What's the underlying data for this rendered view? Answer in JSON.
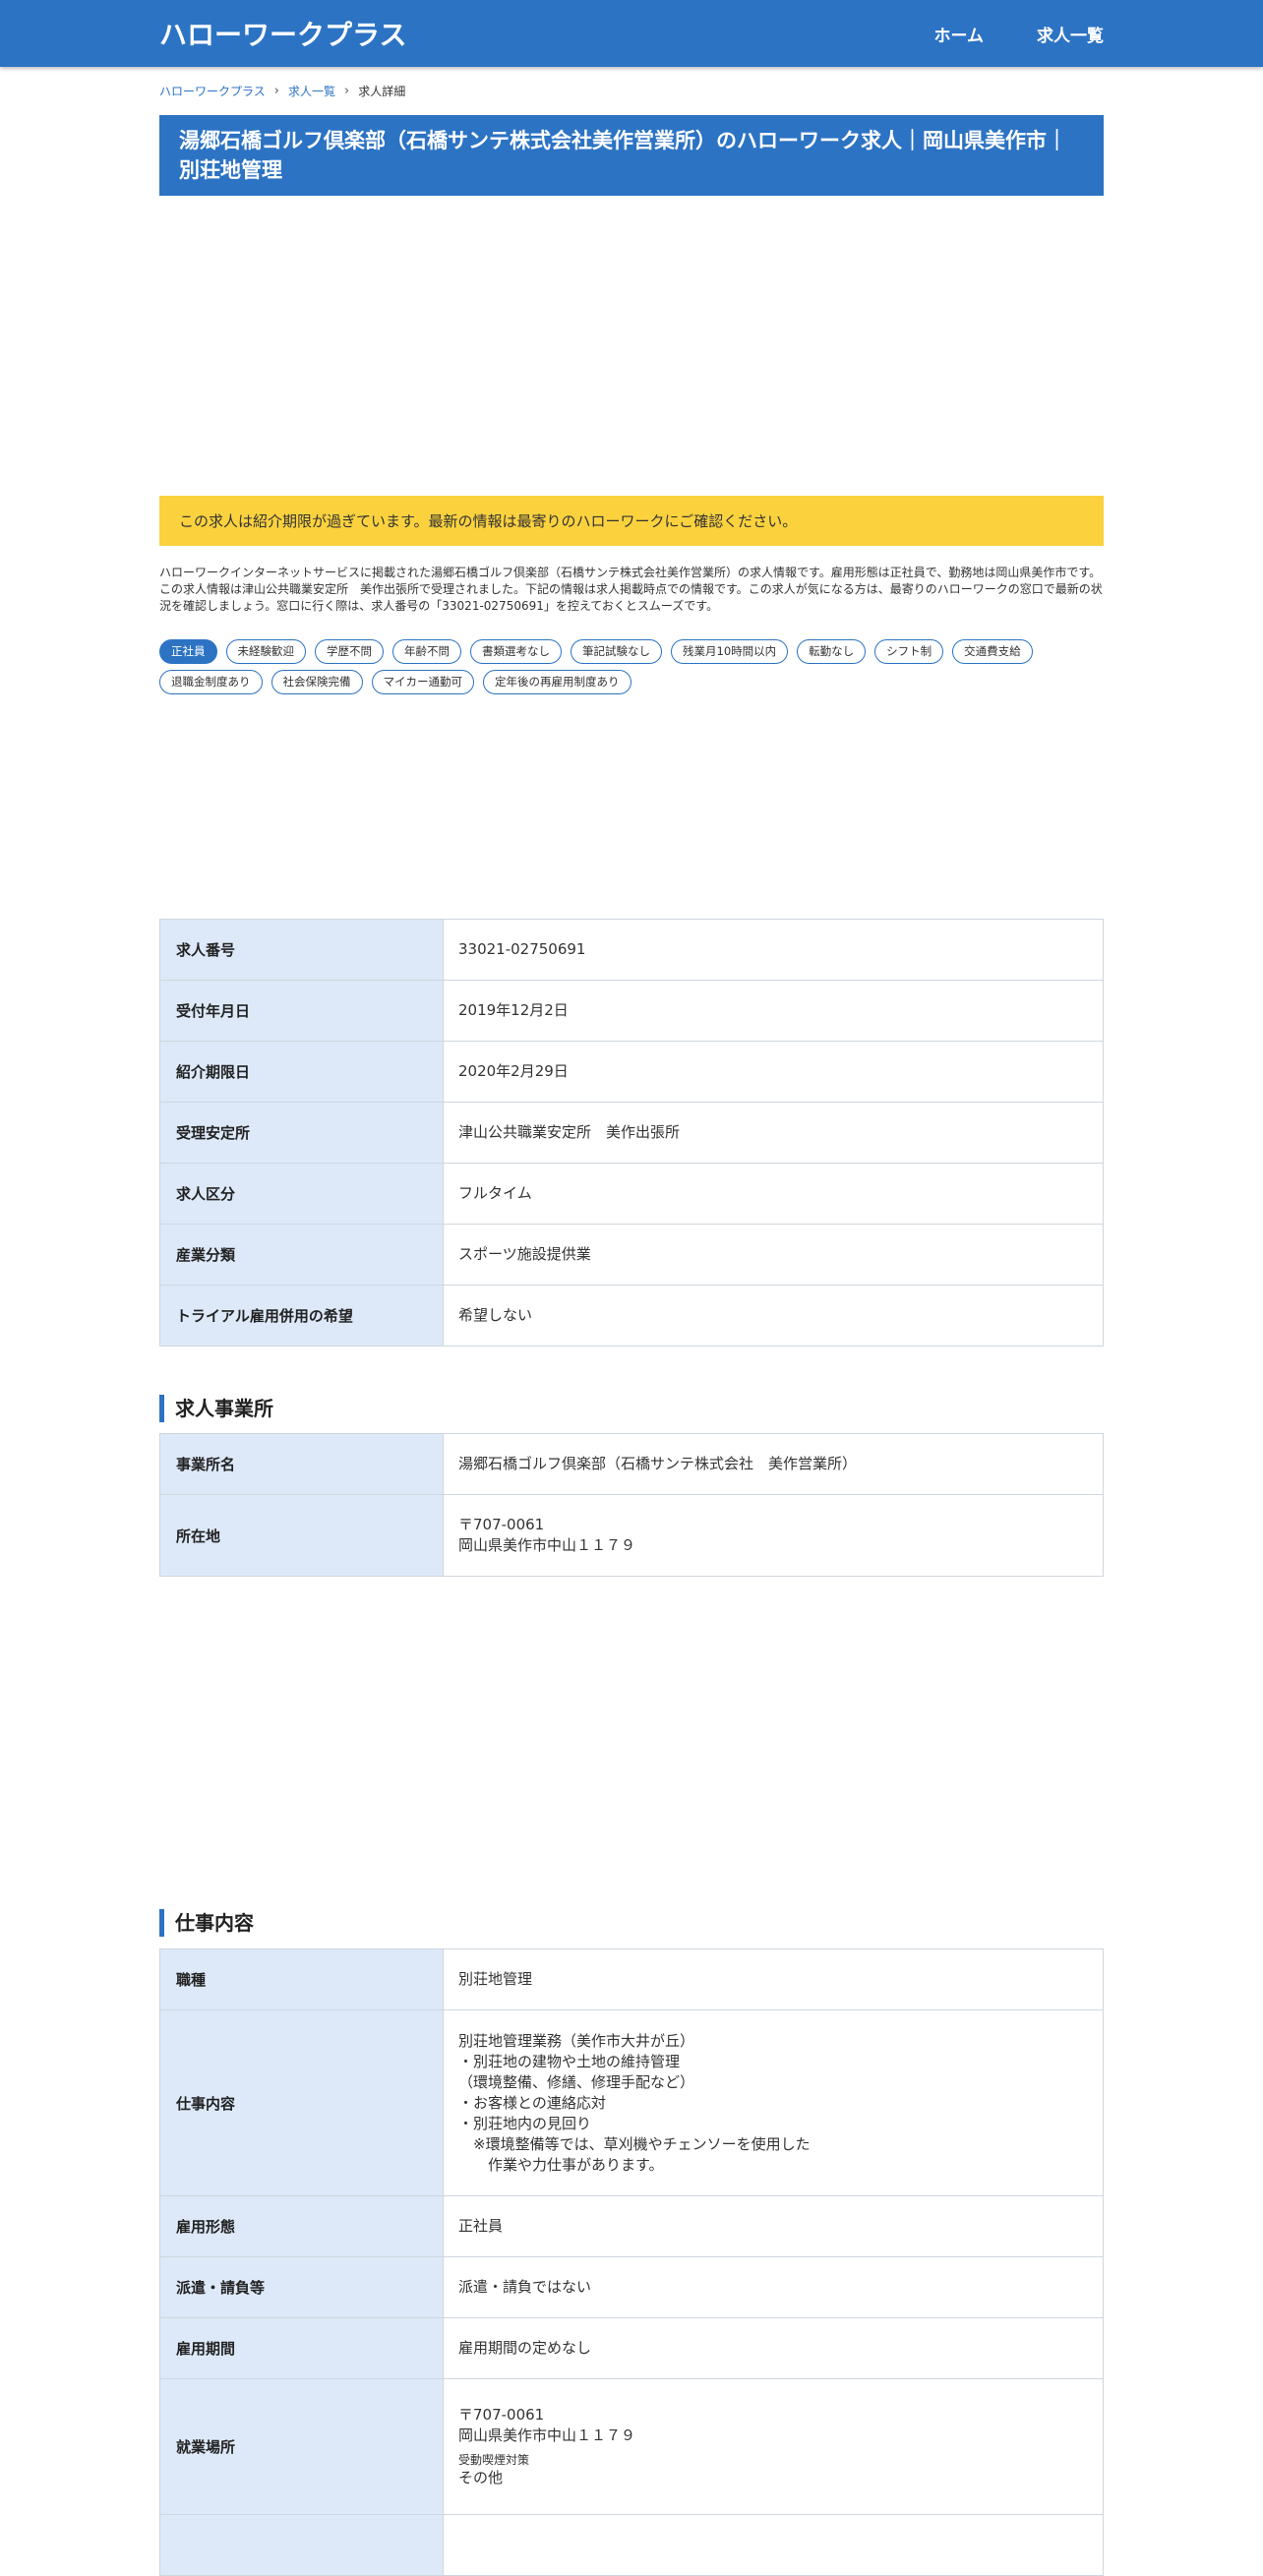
{
  "header": {
    "brand": "ハローワークプラス",
    "nav": [
      "ホーム",
      "求人一覧"
    ]
  },
  "breadcrumb": [
    "ハローワークプラス",
    "求人一覧",
    "求人詳細"
  ],
  "title": "湯郷石橋ゴルフ倶楽部（石橋サンテ株式会社美作営業所）のハローワーク求人｜岡山県美作市｜別荘地管理",
  "notice": "この求人は紹介期限が過ぎています。最新の情報は最寄りのハローワークにご確認ください。",
  "description": "ハローワークインターネットサービスに掲載された湯郷石橋ゴルフ倶楽部（石橋サンテ株式会社美作営業所）の求人情報です。雇用形態は正社員で、勤務地は岡山県美作市です。この求人情報は津山公共職業安定所　美作出張所で受理されました。下記の情報は求人掲載時点での情報です。この求人が気になる方は、最寄りのハローワークの窓口で最新の状況を確認しましょう。窓口に行く際は、求人番号の「33021-02750691」を控えておくとスムーズです。",
  "tags": [
    "正社員",
    "未経験歓迎",
    "学歴不問",
    "年齢不問",
    "書類選考なし",
    "筆記試験なし",
    "残業月10時間以内",
    "転勤なし",
    "シフト制",
    "交通費支給",
    "退職金制度あり",
    "社会保険完備",
    "マイカー通勤可",
    "定年後の再雇用制度あり"
  ],
  "basic": [
    {
      "label": "求人番号",
      "value": "33021-02750691"
    },
    {
      "label": "受付年月日",
      "value": "2019年12月2日"
    },
    {
      "label": "紹介期限日",
      "value": "2020年2月29日"
    },
    {
      "label": "受理安定所",
      "value": "津山公共職業安定所　美作出張所"
    },
    {
      "label": "求人区分",
      "value": "フルタイム"
    },
    {
      "label": "産業分類",
      "value": "スポーツ施設提供業"
    },
    {
      "label": "トライアル雇用併用の希望",
      "value": "希望しない"
    }
  ],
  "office": {
    "heading": "求人事業所",
    "name_label": "事業所名",
    "name": "湯郷石橋ゴルフ倶楽部（石橋サンテ株式会社　美作営業所）",
    "address_label": "所在地",
    "postal": "〒707-0061",
    "address": "岡山県美作市中山１１７９"
  },
  "work": {
    "heading": "仕事内容",
    "job_label": "職種",
    "job": "別荘地管理",
    "content_label": "仕事内容",
    "content_lines": [
      "別荘地管理業務（美作市大井が丘）",
      "・別荘地の建物や土地の維持管理",
      "（環境整備、修繕、修理手配など）",
      "・お客様との連絡応対",
      "・別荘地内の見回り",
      "　※環境整備等では、草刈機やチェンソーを使用した",
      "　　作業や力仕事があります。"
    ],
    "employment_label": "雇用形態",
    "employment": "正社員",
    "dispatch_label": "派遣・請負等",
    "dispatch": "派遣・請負ではない",
    "period_label": "雇用期間",
    "period": "雇用期間の定めなし",
    "place_label": "就業場所",
    "place_postal": "〒707-0061",
    "place_address": "岡山県美作市中山１１７９",
    "smoking_label": "受動喫煙対策",
    "smoking": "その他"
  }
}
